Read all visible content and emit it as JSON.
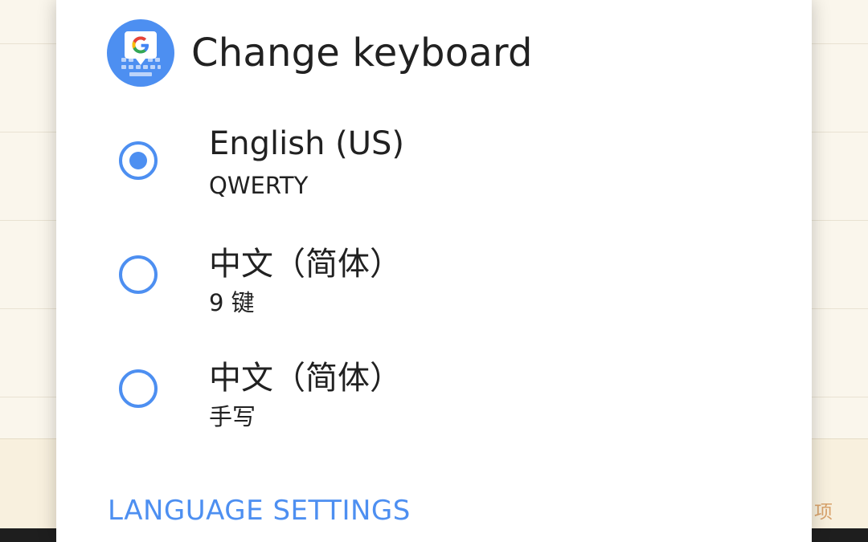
{
  "background_app": {
    "footer_text": "项"
  },
  "dialog": {
    "title": "Change keyboard",
    "icon": "gboard-icon",
    "options": [
      {
        "label": "English (US)",
        "sublabel": "QWERTY",
        "selected": true
      },
      {
        "label": "中文（简体）",
        "sublabel": "9 键",
        "selected": false
      },
      {
        "label": "中文（简体）",
        "sublabel": "手写",
        "selected": false
      }
    ],
    "language_settings_label": "LANGUAGE SETTINGS"
  },
  "colors": {
    "accent": "#4d8ff1",
    "text": "#212121",
    "dialog_bg": "#ffffff",
    "background": "#faf6ec"
  }
}
